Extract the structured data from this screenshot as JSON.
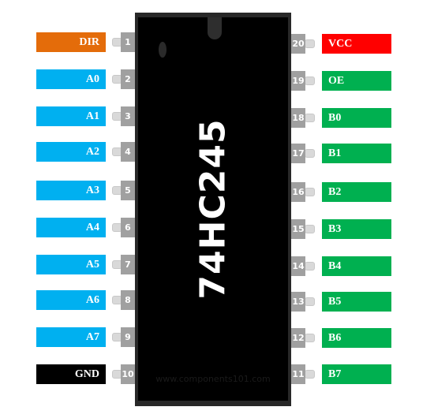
{
  "chip": {
    "name": "74HC245",
    "watermark": "www.components101.com"
  },
  "colors": {
    "control": "#e46c0a",
    "data_a": "#00b0f0",
    "data_b": "#00b050",
    "vcc": "#ff0000",
    "gnd": "#000000"
  },
  "left_pins": [
    {
      "num": "1",
      "label": "DIR",
      "color": "#e46c0a"
    },
    {
      "num": "2",
      "label": "A0",
      "color": "#00b0f0"
    },
    {
      "num": "3",
      "label": "A1",
      "color": "#00b0f0"
    },
    {
      "num": "4",
      "label": "A2",
      "color": "#00b0f0"
    },
    {
      "num": "5",
      "label": "A3",
      "color": "#00b0f0"
    },
    {
      "num": "6",
      "label": "A4",
      "color": "#00b0f0"
    },
    {
      "num": "7",
      "label": "A5",
      "color": "#00b0f0"
    },
    {
      "num": "8",
      "label": "A6",
      "color": "#00b0f0"
    },
    {
      "num": "9",
      "label": "A7",
      "color": "#00b0f0"
    },
    {
      "num": "10",
      "label": "GND",
      "color": "#000000"
    }
  ],
  "right_pins": [
    {
      "num": "20",
      "label": "VCC",
      "color": "#ff0000"
    },
    {
      "num": "19",
      "label": "OE",
      "color": "#00b050"
    },
    {
      "num": "18",
      "label": "B0",
      "color": "#00b050"
    },
    {
      "num": "17",
      "label": "B1",
      "color": "#00b050"
    },
    {
      "num": "16",
      "label": "B2",
      "color": "#00b050"
    },
    {
      "num": "15",
      "label": "B3",
      "color": "#00b050"
    },
    {
      "num": "14",
      "label": "B4",
      "color": "#00b050"
    },
    {
      "num": "13",
      "label": "B5",
      "color": "#00b050"
    },
    {
      "num": "12",
      "label": "B6",
      "color": "#00b050"
    },
    {
      "num": "11",
      "label": "B7",
      "color": "#00b050"
    }
  ]
}
